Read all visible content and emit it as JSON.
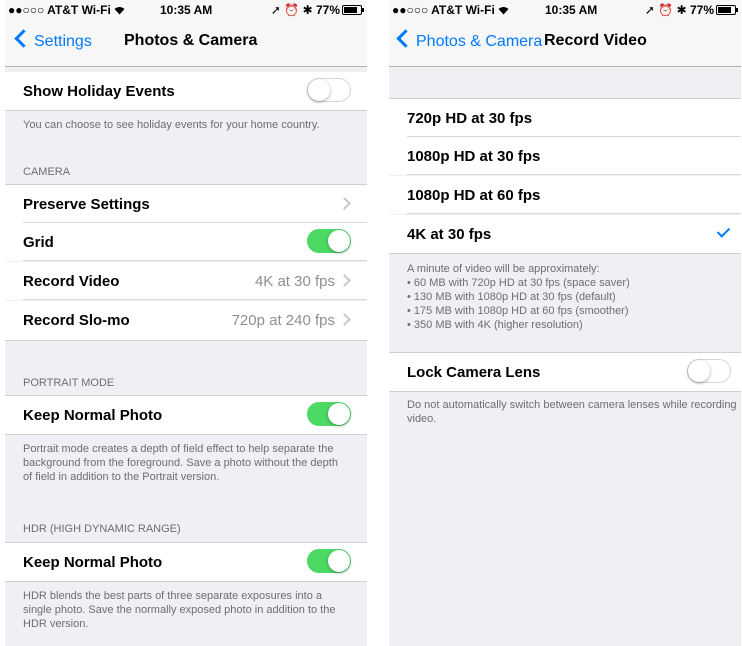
{
  "colors": {
    "accent": "#007aff",
    "switch_on": "#4cd964",
    "group_bg": "#efeff4"
  },
  "left": {
    "status": {
      "carrier": "●●○○○ AT&T Wi-Fi ",
      "wifi_icon": "wifi-icon",
      "time": "10:35 AM",
      "indicators": "➚ ⏰ ✱ 77%",
      "battery_icon": "battery-icon"
    },
    "nav": {
      "back_label": "Settings",
      "title": "Photos & Camera"
    },
    "holiday": {
      "label": "Show Holiday Events",
      "enabled": false,
      "footer": "You can choose to see holiday events for your home country."
    },
    "camera": {
      "header": "CAMERA",
      "preserve_label": "Preserve Settings",
      "grid_label": "Grid",
      "grid_enabled": true,
      "record_video_label": "Record Video",
      "record_video_value": "4K at 30 fps",
      "slomo_label": "Record Slo-mo",
      "slomo_value": "720p at 240 fps"
    },
    "portrait": {
      "header": "PORTRAIT MODE",
      "label": "Keep Normal Photo",
      "enabled": true,
      "footer": "Portrait mode creates a depth of field effect to help separate the background from the foreground. Save a photo without the depth of field in addition to the Portrait version."
    },
    "hdr": {
      "header": "HDR (HIGH DYNAMIC RANGE)",
      "label": "Keep Normal Photo",
      "enabled": true,
      "footer": "HDR blends the best parts of three separate exposures into a single photo. Save the normally exposed photo in addition to the HDR version."
    }
  },
  "right": {
    "status": {
      "carrier": "●●○○○ AT&T Wi-Fi ",
      "wifi_icon": "wifi-icon",
      "time": "10:35 AM",
      "indicators": "➚ ⏰ ✱ 77%",
      "battery_icon": "battery-icon"
    },
    "nav": {
      "back_label": "Photos & Camera",
      "title": "Record Video"
    },
    "options": [
      {
        "label": "720p HD at 30 fps",
        "selected": false
      },
      {
        "label": "1080p HD at 30 fps",
        "selected": false
      },
      {
        "label": "1080p HD at 60 fps",
        "selected": false
      },
      {
        "label": "4K at 30 fps",
        "selected": true
      }
    ],
    "info": {
      "line1": "A minute of video will be approximately:",
      "line2": "• 60 MB with 720p HD at 30 fps (space saver)",
      "line3": "• 130 MB with 1080p HD at 30 fps (default)",
      "line4": "• 175 MB with 1080p HD at 60 fps (smoother)",
      "line5": "• 350 MB with 4K (higher resolution)"
    },
    "lens": {
      "label": "Lock Camera Lens",
      "enabled": false,
      "footer": "Do not automatically switch between camera lenses while recording video."
    }
  }
}
